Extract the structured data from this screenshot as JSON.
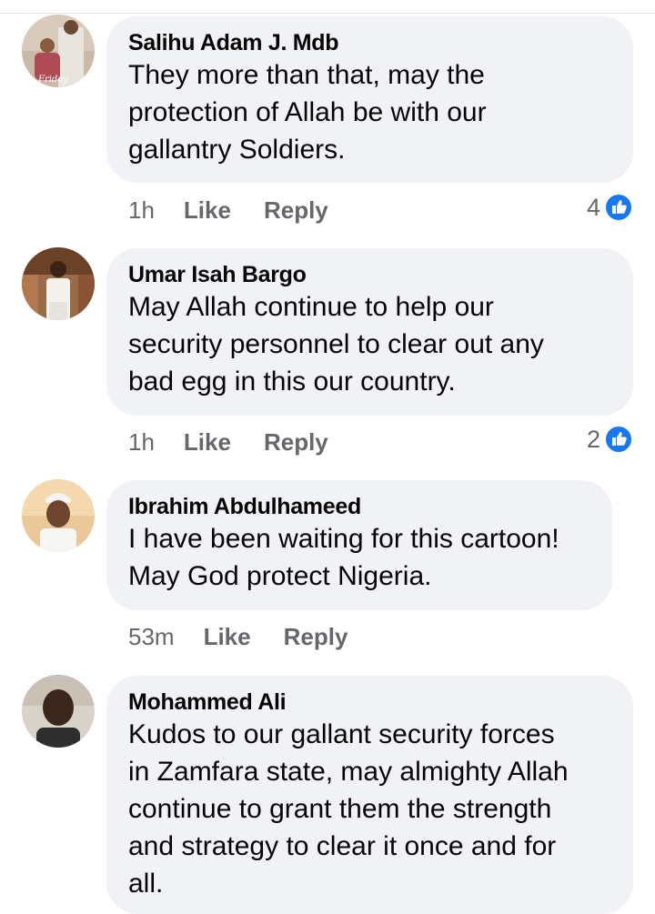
{
  "comments": [
    {
      "author": "Salihu Adam J. Mdb",
      "lines": [
        "They more than that, may the",
        "protection of Allah be with our",
        "gallantry Soldiers."
      ],
      "time": "1h",
      "like_label": "Like",
      "reply_label": "Reply",
      "reaction_count": "4",
      "avatar_icon": "profile-photo-avatar"
    },
    {
      "author": "Umar Isah Bargo",
      "lines": [
        "May Allah continue to help our",
        "security personnel to clear out any",
        "bad egg in this our country."
      ],
      "time": "1h",
      "like_label": "Like",
      "reply_label": "Reply",
      "reaction_count": "2",
      "avatar_icon": "profile-photo-avatar"
    },
    {
      "author": "Ibrahim Abdulhameed",
      "lines": [
        "I have been waiting for this cartoon!",
        "May God protect Nigeria."
      ],
      "time": "53m",
      "like_label": "Like",
      "reply_label": "Reply",
      "avatar_icon": "profile-photo-avatar"
    },
    {
      "author": "Mohammed Ali",
      "lines": [
        "Kudos to our gallant security forces",
        "in Zamfara state, may almighty Allah",
        "continue to grant them the strength",
        "and strategy to clear it once and for",
        "all."
      ],
      "avatar_icon": "profile-photo-avatar"
    }
  ],
  "colors": {
    "bubble": "#f0f2f5",
    "secondary_text": "#65676b",
    "like_blue": "#1877f2"
  },
  "icons": {
    "reaction": "like-thumb-icon"
  }
}
